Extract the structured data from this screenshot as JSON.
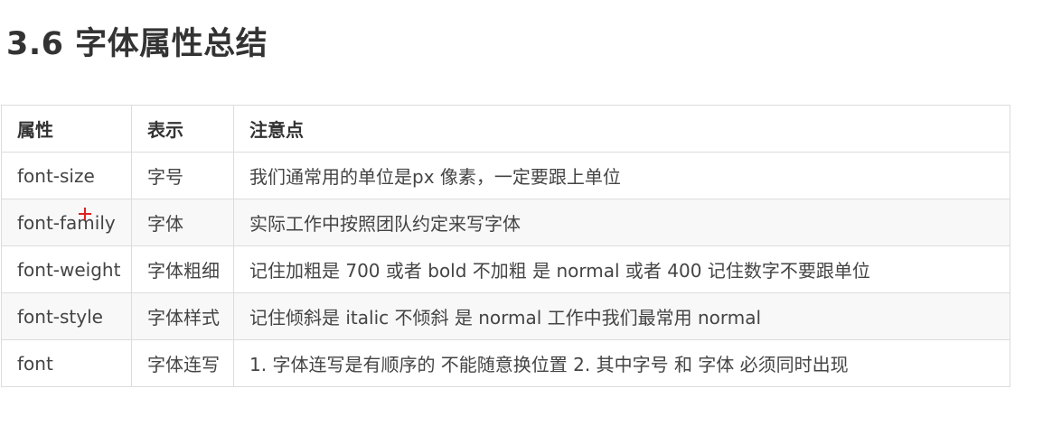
{
  "page": {
    "title": "3.6 字体属性总结"
  },
  "table": {
    "headers": [
      "属性",
      "表示",
      "注意点"
    ],
    "rows": [
      [
        "font-size",
        "字号",
        "我们通常用的单位是px 像素，一定要跟上单位"
      ],
      [
        "font-family",
        "字体",
        "实际工作中按照团队约定来写字体"
      ],
      [
        "font-weight",
        "字体粗细",
        "记住加粗是 700 或者 bold  不加粗 是 normal 或者  400  记住数字不要跟单位"
      ],
      [
        "font-style",
        "字体样式",
        "记住倾斜是 italic    不倾斜 是 normal  工作中我们最常用 normal"
      ],
      [
        "font",
        "字体连写",
        "1. 字体连写是有顺序的  不能随意换位置 2. 其中字号 和 字体 必须同时出现"
      ]
    ]
  },
  "colors": {
    "cursor": "#e02020",
    "border": "#dcdcdc",
    "text": "#333333"
  }
}
